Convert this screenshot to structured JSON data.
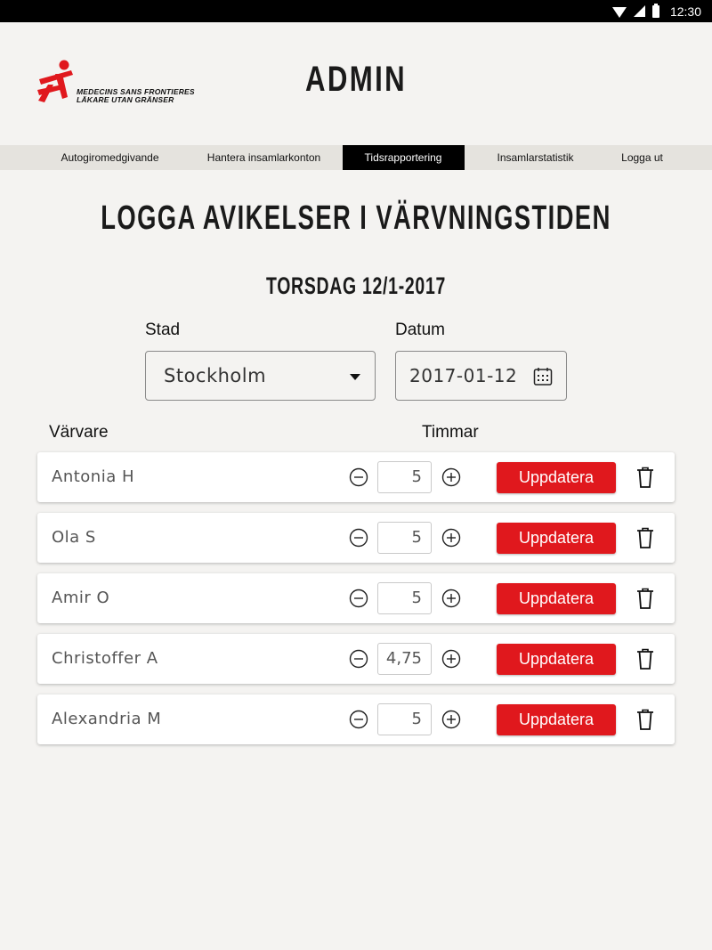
{
  "status_bar": {
    "time": "12:30"
  },
  "header": {
    "logo_line1": "MEDECINS SANS FRONTIERES",
    "logo_line2": "LÄKARE UTAN GRÄNSER",
    "title": "ADMIN"
  },
  "nav": {
    "items": [
      {
        "label": "Autogiromedgivande",
        "active": false
      },
      {
        "label": "Hantera insamlarkonton",
        "active": false
      },
      {
        "label": "Tidsrapportering",
        "active": true
      },
      {
        "label": "Insamlarstatistik",
        "active": false
      },
      {
        "label": "Logga ut",
        "active": false
      }
    ]
  },
  "main": {
    "heading": "LOGGA AVIKELSER I VÄRVNINGSTIDEN",
    "date_heading": "TORSDAG 12/1-2017",
    "city_label": "Stad",
    "city_value": "Stockholm",
    "date_label": "Datum",
    "date_value": "2017-01-12",
    "col_recruiter": "Värvare",
    "col_hours": "Timmar",
    "update_label": "Uppdatera",
    "rows": [
      {
        "name": "Antonia H",
        "hours": "5"
      },
      {
        "name": "Ola S",
        "hours": "5"
      },
      {
        "name": "Amir O",
        "hours": "5"
      },
      {
        "name": "Christoffer A",
        "hours": "4,75"
      },
      {
        "name": "Alexandria M",
        "hours": "5"
      }
    ]
  },
  "colors": {
    "accent": "#e0181d",
    "background": "#f4f3f1",
    "nav_bg": "#e5e3de",
    "nav_active": "#000000"
  }
}
